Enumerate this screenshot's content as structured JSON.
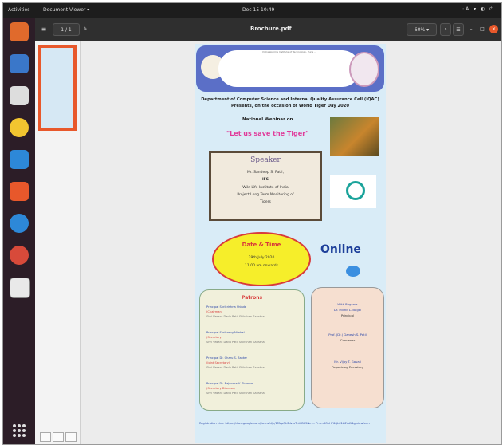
{
  "topbar": {
    "activities": "Activities",
    "app": "Document Viewer ▾",
    "clock": "Dec 15  10:49",
    "sys": "⋅A ▾ ◐ ⏻"
  },
  "viewer": {
    "title": "Brochure.pdf",
    "page_box": "1 / 1",
    "zoom": "60% ▾"
  },
  "page": {
    "banner_text": "Vishwakarma Institute of Technology, Pune ...",
    "dept": "Department of Computer Science and Internal Quality Assurance Cell (IQAC) Presents, on the occasion of World Tiger Day 2020",
    "webinar": "National Webinar on",
    "title": "\"Let us save the Tiger\"",
    "speaker_heading": "Speaker",
    "speaker_lines": [
      "Mr. Sandeep S. Patil,",
      "IFS",
      "Wild Life Institute of India",
      "Project Long Term Monitoring of",
      "Tigers"
    ],
    "dt_heading": "Date & Time",
    "dt_lines": [
      "29th July 2020",
      "11.00 am onwards"
    ],
    "online": "Online",
    "patrons_heading": "Patrons",
    "patrons": [
      {
        "name": "Principal Shrikrishna Shinde",
        "role": "(Chairman)",
        "org": "Shri Vasant Dada Patil Shikshan Sanstha"
      },
      {
        "name": "Principal Shrikrang Nimbal",
        "role": "(Secretary)",
        "org": "Shri Vasant Dada Patil Shikshan Sanstha"
      },
      {
        "name": "Principal Dr. Charu S. Baxter",
        "role": "(Joint Secretary)",
        "org": "Shri Vasant Dada Patil Shikshan Sanstha"
      },
      {
        "name": "Principal Dr. Rajendra V. Sharma",
        "role": "(Secretary Director)",
        "org": "Shri Vasant Dada Patil Shikshan Sanstha"
      }
    ],
    "wb_lines": [
      "With Regards",
      "Dr. Milind L. Bagal",
      "Principal",
      "",
      "Prof. (Dr.) Ganesh S. Patil",
      "Convener",
      "",
      "Mr. Vijay T. Gavali",
      "Organizing Secretary"
    ],
    "reg": "Registration Link: https://docs.google.com/forms/d/e/1FAIpQLSdvrxTnVJBC5Nm... Pr-tmSOnHF6QLC1b6Yd14g/viewform"
  },
  "colors": {
    "accent": "#e8582b",
    "title_pink": "#e03a9a",
    "dt_yellow": "#f6ee2a",
    "online_blue": "#1d3f9a"
  },
  "icons": [
    "firefox-icon",
    "thunderbird-icon",
    "files-icon",
    "rhythmbox-icon",
    "writer-icon",
    "software-icon",
    "help-icon",
    "chrome-icon",
    "document-viewer-icon",
    "apps-grid-icon"
  ]
}
